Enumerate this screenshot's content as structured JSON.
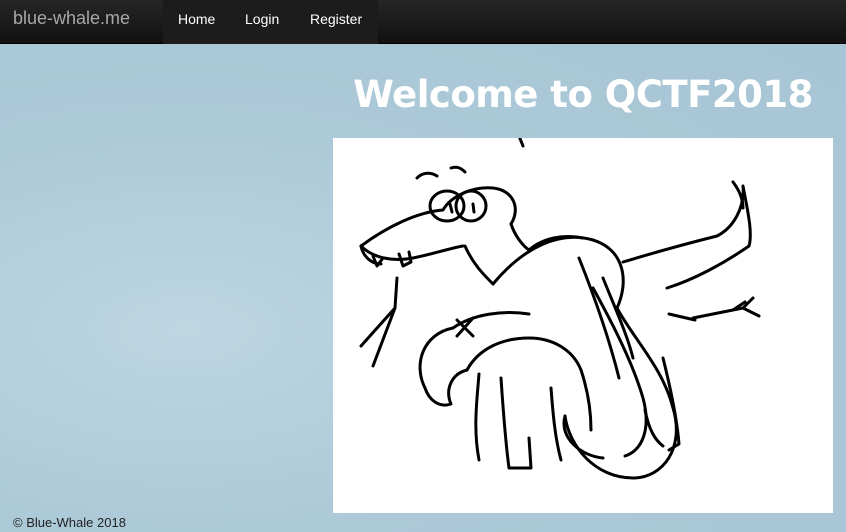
{
  "navbar": {
    "brand": "blue-whale.me",
    "items": [
      {
        "label": "Home"
      },
      {
        "label": "Login"
      },
      {
        "label": "Register"
      }
    ]
  },
  "main": {
    "title": "Welcome to QCTF2018",
    "image": {
      "subject": "snake-wrapped-elephant-drawing"
    }
  },
  "footer": {
    "text": "© Blue-Whale 2018"
  }
}
